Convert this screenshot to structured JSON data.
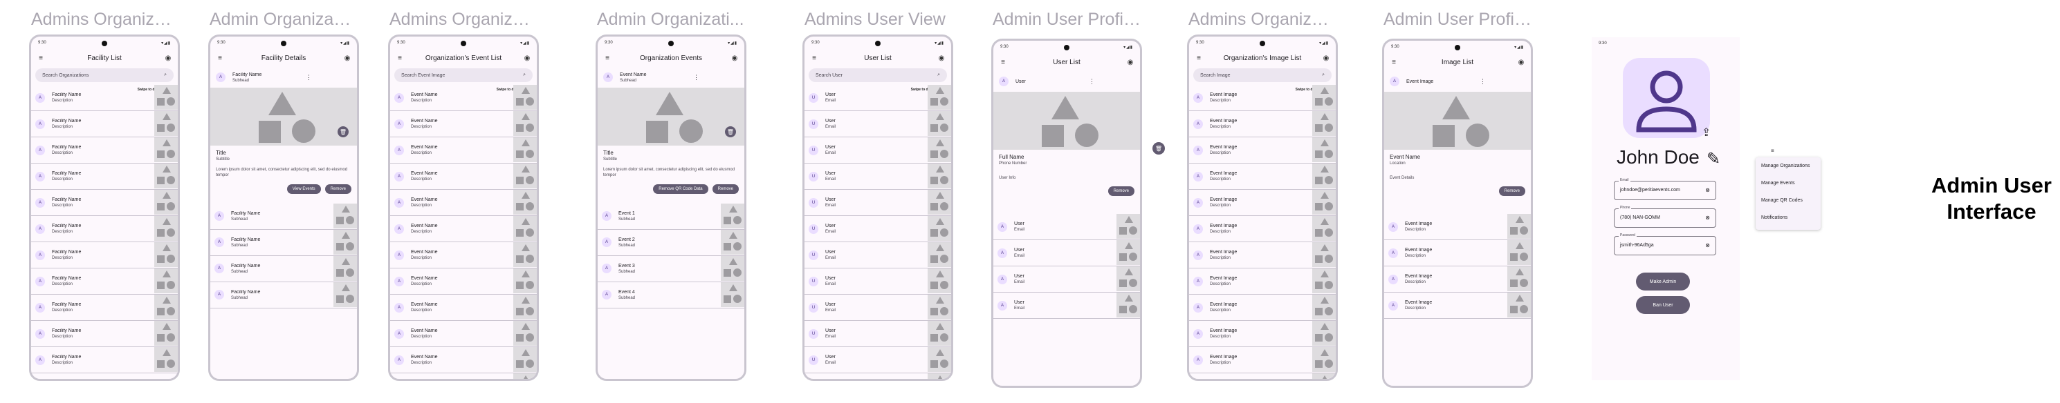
{
  "labels": [
    "Admins Organizat...",
    "Admin Organizati...",
    "Admins Organizat...",
    "Admin Organizati...",
    "Admins User View",
    "Admin User Profil...",
    "Admins Organizat...",
    "Admin User Profil..."
  ],
  "status": {
    "time": "9:30",
    "icons": "▾◢▮"
  },
  "icons": {
    "menu": "menu-icon",
    "search": "search-icon",
    "account": "account-icon",
    "more": "more-vert-icon",
    "delete": "delete-icon",
    "share": "share-icon",
    "edit": "edit-icon",
    "clear": "cancel-icon"
  },
  "swipe": "Swipe to delete",
  "screen1": {
    "title": "Facility List",
    "search": "Search Organizations",
    "item_title": "Facility Name",
    "item_sub": "Description",
    "avatar": "A",
    "count": 11
  },
  "screen2": {
    "title": "Facility Details",
    "header_title": "Facility Name",
    "header_sub": "Subhead",
    "content_title": "Title",
    "content_sub": "Subtitle",
    "body": "Lorem ipsum dolor sit amet, consectetur adipiscing elit, sed do eiusmod tempor",
    "buttons": [
      "View Events",
      "Remove"
    ],
    "list": [
      {
        "title": "Facility Name",
        "sub": "Subhead"
      },
      {
        "title": "Facility Name",
        "sub": "Subhead"
      },
      {
        "title": "Facility Name",
        "sub": "Subhead"
      },
      {
        "title": "Facility Name",
        "sub": "Subhead"
      }
    ]
  },
  "screen3": {
    "title": "Organization's Event List",
    "search": "Search Event Image",
    "item_title": "Event Name",
    "item_sub": "Description",
    "count": 12
  },
  "screen4": {
    "title": "Organization Events",
    "header_title": "Event Name",
    "header_sub": "Subhead",
    "content_title": "Title",
    "content_sub": "Subtitle",
    "body": "Lorem ipsum dolor sit amet, consectetur adipiscing elit, sed do eiusmod tempor",
    "buttons": [
      "Remove QR Code Data",
      "Remove"
    ],
    "list": [
      {
        "title": "Event 1",
        "sub": "Subhead"
      },
      {
        "title": "Event 2",
        "sub": "Subhead"
      },
      {
        "title": "Event 3",
        "sub": "Subhead"
      },
      {
        "title": "Event 4",
        "sub": "Subhead"
      }
    ]
  },
  "screen5": {
    "title": "User List",
    "search": "Search User",
    "item_title": "User",
    "item_sub": "Email",
    "avatar": "U",
    "count": 12
  },
  "screen6": {
    "title": "User List",
    "header_title": "User",
    "content_title": "Full Name",
    "content_sub": "Phone Number",
    "info": "User Info",
    "button": "Remove",
    "list": [
      {
        "title": "User",
        "sub": "Email"
      },
      {
        "title": "User",
        "sub": "Email"
      },
      {
        "title": "User",
        "sub": "Email"
      },
      {
        "title": "User",
        "sub": "Email"
      }
    ]
  },
  "screen7": {
    "title": "Organization's Image List",
    "search": "Search Image",
    "item_title": "Event Image",
    "item_sub": "Description",
    "count": 12
  },
  "screen8": {
    "title": "Image List",
    "header_title": "Event Image",
    "content_title": "Event Name",
    "content_sub": "Location",
    "info": "Event Details",
    "button": "Remove",
    "list": [
      {
        "title": "Event Image",
        "sub": "Description"
      },
      {
        "title": "Event Image",
        "sub": "Description"
      },
      {
        "title": "Event Image",
        "sub": "Description"
      },
      {
        "title": "Event Image",
        "sub": "Description"
      }
    ]
  },
  "profile": {
    "name": "John Doe",
    "fields": [
      {
        "label": "Email",
        "value": "johndoe@peritiaevents.com"
      },
      {
        "label": "Phone",
        "value": "(780) NAN-GOMM"
      },
      {
        "label": "Password",
        "value": "jsmith-96Ad5ga"
      }
    ],
    "buttons": [
      "Make Admin",
      "Ban User"
    ]
  },
  "menu": [
    "Manage Organizations",
    "Manage Events",
    "Manage QR Codes",
    "Notifications"
  ],
  "title": "Admin User Interface"
}
